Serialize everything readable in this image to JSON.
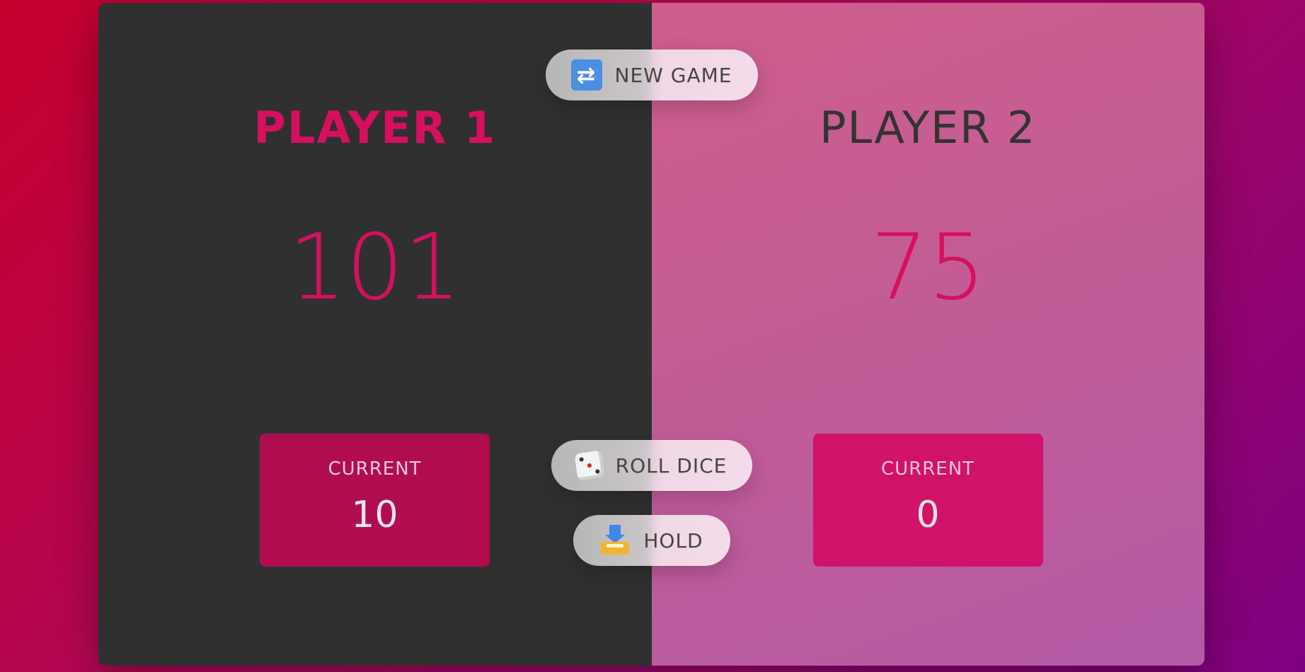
{
  "players": [
    {
      "name": "PLAYER 1",
      "score": "101",
      "current_label": "CURRENT",
      "current_score": "10",
      "active": true
    },
    {
      "name": "PLAYER 2",
      "score": "75",
      "current_label": "CURRENT",
      "current_score": "0",
      "active": false
    }
  ],
  "controls": {
    "new_game": {
      "label": "NEW GAME",
      "icon": "repeat-arrows-icon"
    },
    "roll_dice": {
      "label": "ROLL DICE",
      "icon": "dice-icon"
    },
    "hold": {
      "label": "HOLD",
      "icon": "inbox-tray-icon"
    }
  },
  "colors": {
    "accent": "#d6105f",
    "active_panel": "#303030",
    "current_box_player1": "#b00d4f",
    "current_box_player2": "#d1126b"
  }
}
